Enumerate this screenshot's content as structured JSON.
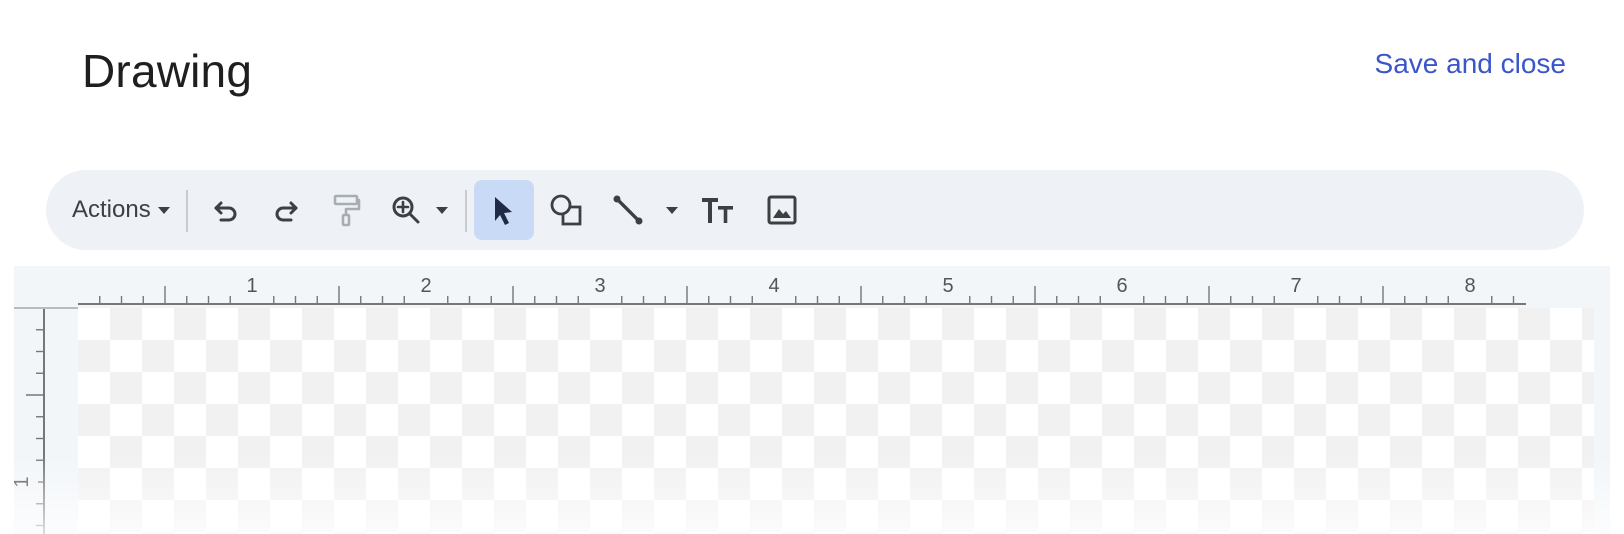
{
  "header": {
    "title": "Drawing",
    "save_label": "Save and close"
  },
  "toolbar": {
    "actions_label": "Actions",
    "tools": [
      {
        "name": "undo",
        "icon": "undo-icon"
      },
      {
        "name": "redo",
        "icon": "redo-icon"
      },
      {
        "name": "paint-format",
        "icon": "paint-roller-icon",
        "disabled": true
      },
      {
        "name": "zoom",
        "icon": "zoom-in-icon",
        "has_menu": true
      },
      {
        "name": "select",
        "icon": "cursor-arrow-icon",
        "selected": true
      },
      {
        "name": "shape",
        "icon": "shapes-icon"
      },
      {
        "name": "line",
        "icon": "line-icon",
        "has_menu": true
      },
      {
        "name": "text-box",
        "icon": "text-box-icon"
      },
      {
        "name": "image",
        "icon": "image-icon"
      }
    ]
  },
  "ruler": {
    "horizontal_labels": [
      "1",
      "2",
      "3",
      "4",
      "5",
      "6",
      "7",
      "8"
    ],
    "vertical_labels": [
      "1"
    ]
  },
  "colors": {
    "accent": "#3a56c9",
    "toolbar_bg": "#eef2f6",
    "selected_tool_bg": "#c9daf6",
    "canvas_bg": "#f2f6f9"
  }
}
